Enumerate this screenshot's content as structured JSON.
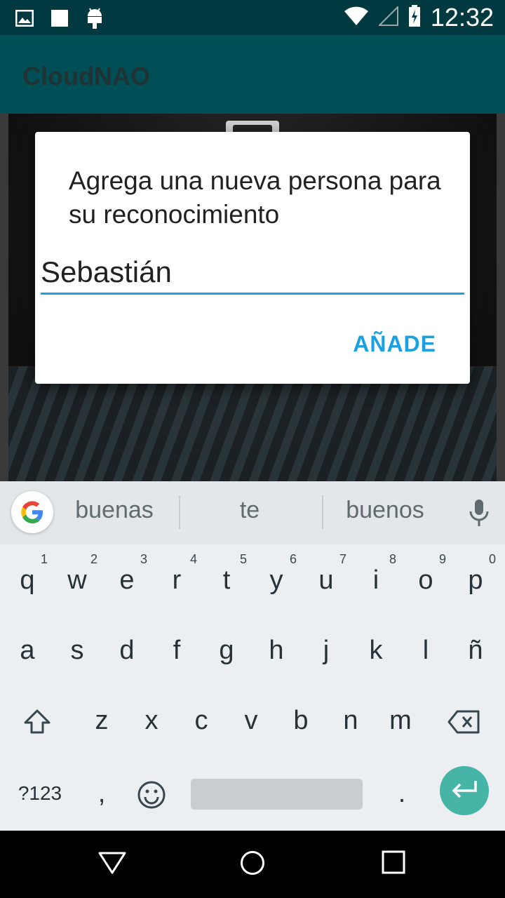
{
  "status_bar": {
    "time": "12:32",
    "left_icons": [
      "image-notification-icon",
      "square-notification-icon",
      "android-icon"
    ],
    "right_icons": [
      "wifi-icon",
      "signal-icon",
      "battery-charging-icon"
    ]
  },
  "app_bar": {
    "title": "CloudNAO"
  },
  "dialog": {
    "message": "Agrega una nueva persona para su reconocimiento",
    "input_value": "Sebastián",
    "confirm_label": "AÑADE",
    "accent_color": "#1ba1e2"
  },
  "keyboard": {
    "suggestions": [
      "buenas",
      "te",
      "buenos"
    ],
    "row1": [
      {
        "char": "q",
        "hint": "1"
      },
      {
        "char": "w",
        "hint": "2"
      },
      {
        "char": "e",
        "hint": "3"
      },
      {
        "char": "r",
        "hint": "4"
      },
      {
        "char": "t",
        "hint": "5"
      },
      {
        "char": "y",
        "hint": "6"
      },
      {
        "char": "u",
        "hint": "7"
      },
      {
        "char": "i",
        "hint": "8"
      },
      {
        "char": "o",
        "hint": "9"
      },
      {
        "char": "p",
        "hint": "0"
      }
    ],
    "row2": [
      "a",
      "s",
      "d",
      "f",
      "g",
      "h",
      "j",
      "k",
      "l",
      "ñ"
    ],
    "row3": [
      "z",
      "x",
      "c",
      "v",
      "b",
      "n",
      "m"
    ],
    "symbols_label": "?123",
    "comma_label": ",",
    "period_label": ".",
    "enter_color": "#46b5a8"
  },
  "nav_bar": {
    "buttons": [
      "back-icon",
      "home-icon",
      "recents-icon"
    ]
  }
}
